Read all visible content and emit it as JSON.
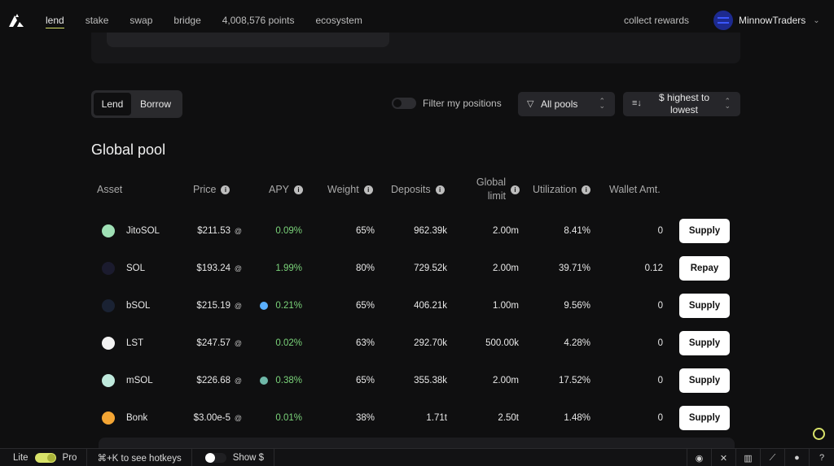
{
  "nav": {
    "items": [
      "lend",
      "stake",
      "swap",
      "bridge",
      "4,008,576 points",
      "ecosystem"
    ],
    "active": "lend",
    "collect_label": "collect rewards",
    "user_name": "MinnowTraders"
  },
  "controls": {
    "lend_label": "Lend",
    "borrow_label": "Borrow",
    "filter_label": "Filter my positions",
    "pools_label": "All pools",
    "sort_label": "$ highest to lowest"
  },
  "section_title": "Global pool",
  "columns": {
    "asset": "Asset",
    "price": "Price",
    "apy": "APY",
    "weight": "Weight",
    "deposits": "Deposits",
    "global_limit": "Global limit",
    "utilization": "Utilization",
    "wallet": "Wallet Amt."
  },
  "rows": [
    {
      "asset": "JitoSOL",
      "price": "$211.53",
      "apy": "0.09%",
      "weight": "65%",
      "deposits": "962.39k",
      "limit": "2.00m",
      "util": "8.41%",
      "wallet": "0",
      "action": "Supply",
      "icon_color": "#9fe0b5",
      "apy_icon": ""
    },
    {
      "asset": "SOL",
      "price": "$193.24",
      "apy": "1.99%",
      "weight": "80%",
      "deposits": "729.52k",
      "limit": "2.00m",
      "util": "39.71%",
      "wallet": "0.12",
      "action": "Repay",
      "icon_color": "#1b1b2e",
      "apy_icon": ""
    },
    {
      "asset": "bSOL",
      "price": "$215.19",
      "apy": "0.21%",
      "weight": "65%",
      "deposits": "406.21k",
      "limit": "1.00m",
      "util": "9.56%",
      "wallet": "0",
      "action": "Supply",
      "icon_color": "#1a2233",
      "apy_icon": "#5ab0ff"
    },
    {
      "asset": "LST",
      "price": "$247.57",
      "apy": "0.02%",
      "weight": "63%",
      "deposits": "292.70k",
      "limit": "500.00k",
      "util": "4.28%",
      "wallet": "0",
      "action": "Supply",
      "icon_color": "#f2f2f2",
      "apy_icon": ""
    },
    {
      "asset": "mSOL",
      "price": "$226.68",
      "apy": "0.38%",
      "weight": "65%",
      "deposits": "355.38k",
      "limit": "2.00m",
      "util": "17.52%",
      "wallet": "0",
      "action": "Supply",
      "icon_color": "#bfe9dc",
      "apy_icon": "#6fb8a8"
    },
    {
      "asset": "Bonk",
      "price": "$3.00e-5",
      "apy": "0.01%",
      "weight": "38%",
      "deposits": "1.71t",
      "limit": "2.50t",
      "util": "1.48%",
      "wallet": "0",
      "action": "Supply",
      "icon_color": "#f3a534",
      "apy_icon": ""
    }
  ],
  "footer": {
    "lite_label": "Lite",
    "pro_label": "Pro",
    "hotkeys_label": "⌘+K to see hotkeys",
    "show_label": "Show $"
  }
}
